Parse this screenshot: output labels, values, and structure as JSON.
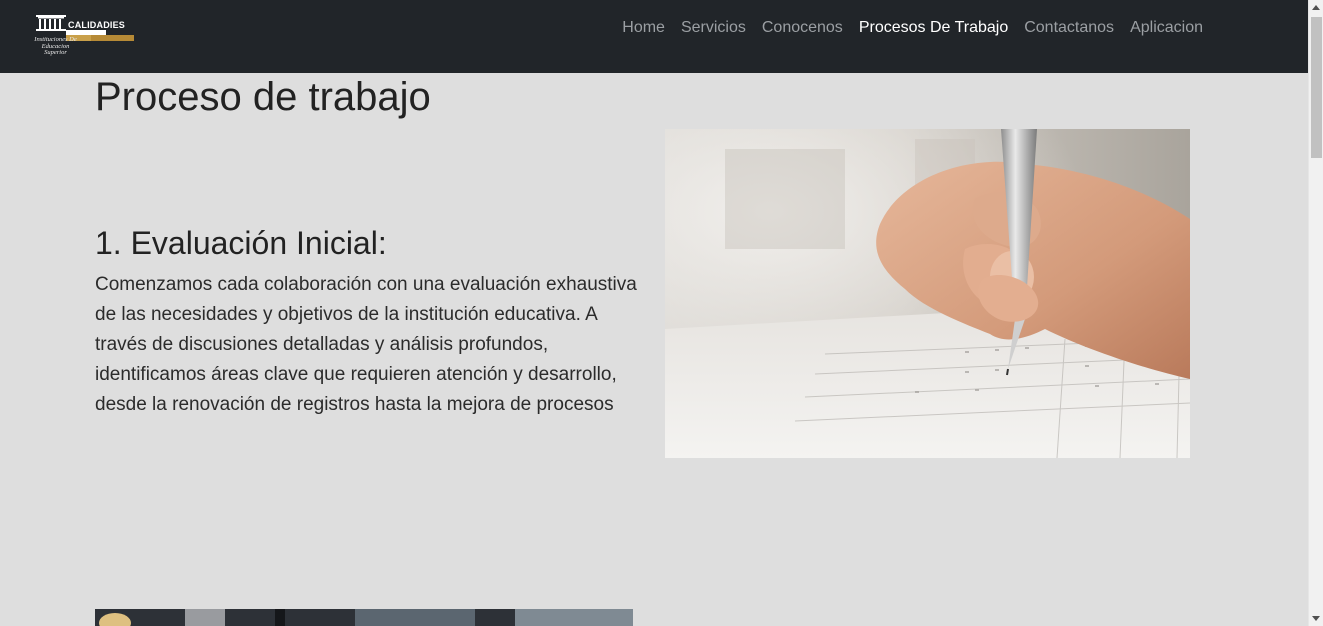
{
  "header": {
    "logo": {
      "wordmark": "CALIDADIES",
      "tagline": "Instituciones De Educacion Superior",
      "icon": "building-columns-icon",
      "accent_color": "#c9a04a"
    },
    "nav": [
      {
        "label": "Home",
        "active": false
      },
      {
        "label": "Servicios",
        "active": false
      },
      {
        "label": "Conocenos",
        "active": false
      },
      {
        "label": "Procesos De Trabajo",
        "active": true
      },
      {
        "label": "Contactanos",
        "active": false
      },
      {
        "label": "Aplicacion",
        "active": false
      }
    ]
  },
  "main": {
    "title": "Proceso de trabajo",
    "sections": [
      {
        "heading": "1. Evaluación Inicial:",
        "text": "Comenzamos cada colaboración con una evaluación exhaustiva de las necesidades y objetivos de la institución educativa. A través de discusiones detalladas y análisis profundos, identificamos áreas clave que requieren atención y desarrollo, desde la renovación de registros hasta la mejora de procesos",
        "image": "hand-writing-with-pen-photo"
      }
    ],
    "next_image": "second-section-photo"
  },
  "colors": {
    "navbar_bg": "#212529",
    "page_bg": "#dedede",
    "nav_link": "#9b9fa3",
    "nav_link_active": "#ffffff"
  }
}
